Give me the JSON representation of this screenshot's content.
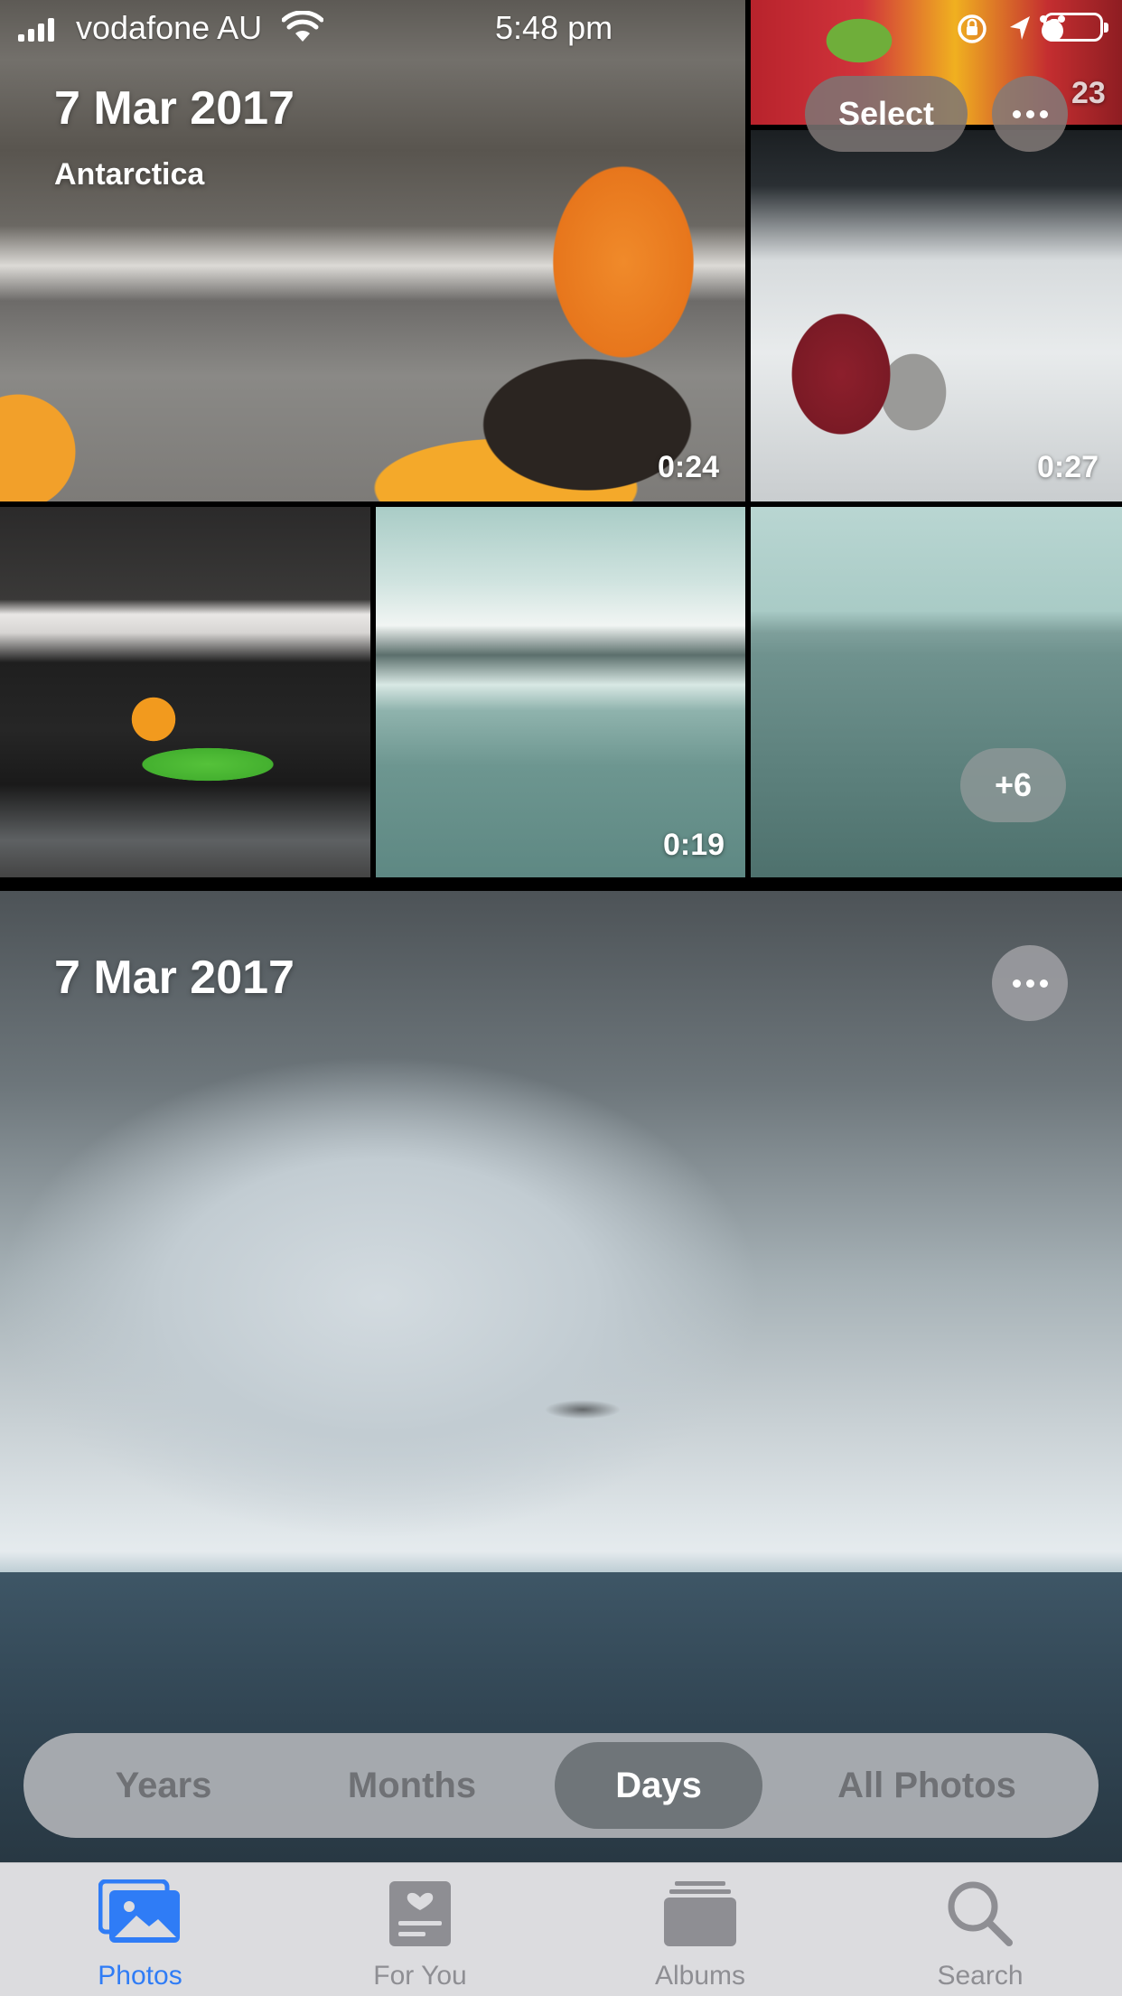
{
  "status_bar": {
    "carrier": "vodafone AU",
    "time": "5:48 pm"
  },
  "section1": {
    "date": "7 Mar 2017",
    "location": "Antarctica",
    "select_label": "Select",
    "durations": [
      "0:24",
      "0:27",
      "0:19"
    ],
    "partial_duration": "23",
    "more_count": "+6"
  },
  "section2": {
    "date": "7 Mar 2017"
  },
  "view_switcher": {
    "options": [
      "Years",
      "Months",
      "Days",
      "All Photos"
    ],
    "selected": "Days"
  },
  "tab_bar": {
    "tabs": [
      "Photos",
      "For You",
      "Albums",
      "Search"
    ],
    "selected": "Photos"
  },
  "colors": {
    "accent": "#2f7cf6",
    "tab_inactive": "#8e8e93",
    "segment_selected": "#6f7579"
  },
  "icons": {
    "photos_tab": "photos-icon",
    "for_you_tab": "for-you-icon",
    "albums_tab": "albums-icon",
    "search_tab": "search-icon",
    "more": "ellipsis-icon"
  }
}
